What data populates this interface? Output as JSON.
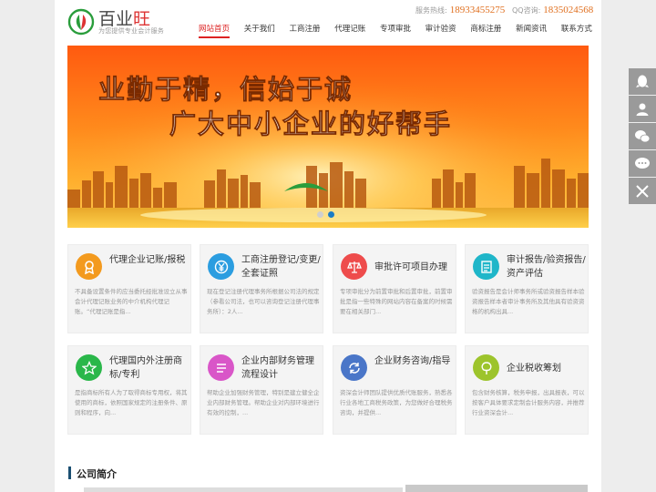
{
  "header": {
    "brand_left": "百业",
    "brand_right": "旺",
    "slogan": "为您提供专业会计服务",
    "hotline_label": "服务热线:",
    "hotline_number": "18933455275",
    "qq_label": "QQ咨询:",
    "qq_number": "1835024568"
  },
  "nav": [
    {
      "label": "网站首页",
      "active": true
    },
    {
      "label": "关于我们"
    },
    {
      "label": "工商注册"
    },
    {
      "label": "代理记账"
    },
    {
      "label": "专项审批"
    },
    {
      "label": "审计验资"
    },
    {
      "label": "商标注册"
    },
    {
      "label": "新闻资讯"
    },
    {
      "label": "联系方式"
    }
  ],
  "banner": {
    "line1": "业勤于精，信始于诚",
    "line2": "广大中小企业的好帮手",
    "slides": 2,
    "active_slide": 2
  },
  "services": [
    {
      "title": "代理企业记账/报税",
      "icon": "award-icon",
      "color": "#f39a1e",
      "desc": "不具备设置条件的应当委托经批准设立从事会计代理记账业务的中介机构代理记账。“代理记账是指..."
    },
    {
      "title": "工商注册登记/变更/全套证照",
      "icon": "yen-icon",
      "color": "#2b9de0",
      "desc": "现在登记注册代理事务所根据公司法的规定（参看公司法，也可以咨询登记注册代理事务所）：2人..."
    },
    {
      "title": "审批许可项目办理",
      "icon": "scale-icon",
      "color": "#ee4c4c",
      "desc": "专项审批分为前置审批和后置审批，前置审批是指一些特殊的网站内容在备案的时候需要在相关部门..."
    },
    {
      "title": "审计报告/验资报告/资产评估",
      "icon": "report-icon",
      "color": "#1fb6c9",
      "desc": "验资报告是会计师事务所或验资报告样本验资报告样本者审计事务所及其他具有验资资格的机构出具..."
    },
    {
      "title": "代理国内外注册商标/专利",
      "icon": "star-icon",
      "color": "#2ab74a",
      "desc": "是指商标所有人为了取得商标专用权，将其使用的商标，依照国家规定的注册条件、原则和程序，向..."
    },
    {
      "title": "企业内部财务管理流程设计",
      "icon": "list-icon",
      "color": "#d956c8",
      "desc": "帮助企业加强财务管理，特别是建立健全企业内部财务管理。帮助企业对内部环境进行有效的控制，..."
    },
    {
      "title": "企业财务咨询/指导",
      "icon": "cycle-icon",
      "color": "#4a76c8",
      "desc": "资深会计师团队提供优质代账服务，熟悉各行业各地工商税务政策，为您做好合理税务咨询，并提供..."
    },
    {
      "title": "企业税收筹划",
      "icon": "tree-icon",
      "color": "#9dc42c",
      "desc": "包含财务核算，税务申报，出具报表，可以按客户具体要求定制会计服务内容，并推荐行业资深会计..."
    }
  ],
  "about": {
    "title": "公司简介"
  },
  "side_tools": [
    "qq-icon",
    "user-icon",
    "wechat-icon",
    "message-icon",
    "close-icon"
  ]
}
